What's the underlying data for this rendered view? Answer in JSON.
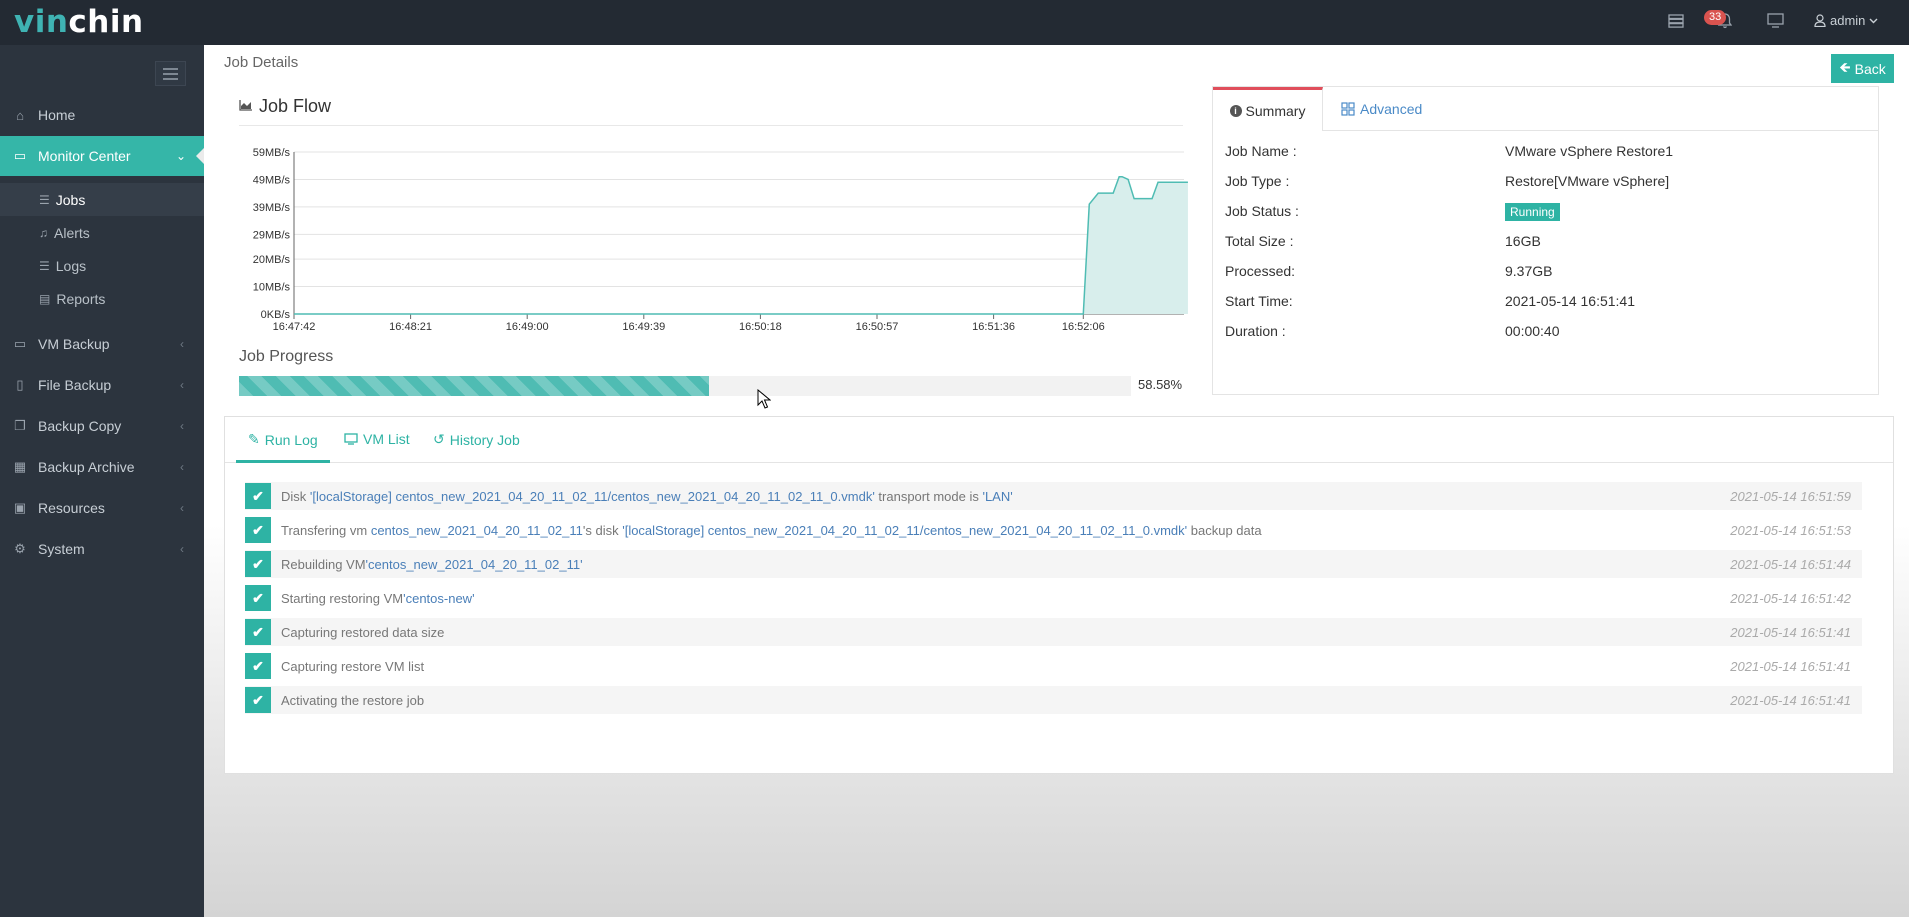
{
  "header": {
    "logo_part1": "vin",
    "logo_part2": "chin",
    "notification_count": "33",
    "user": "admin"
  },
  "sidebar": {
    "items": [
      {
        "label": "Home",
        "icon": "home-icon"
      },
      {
        "label": "Monitor Center",
        "icon": "monitor-icon"
      },
      {
        "label": "VM Backup",
        "icon": "vm-icon"
      },
      {
        "label": "File Backup",
        "icon": "file-icon"
      },
      {
        "label": "Backup Copy",
        "icon": "copy-icon"
      },
      {
        "label": "Backup Archive",
        "icon": "archive-icon"
      },
      {
        "label": "Resources",
        "icon": "resources-icon"
      },
      {
        "label": "System",
        "icon": "gear-icon"
      }
    ],
    "sub_items": [
      {
        "label": "Jobs",
        "icon": "list-icon"
      },
      {
        "label": "Alerts",
        "icon": "bell-icon"
      },
      {
        "label": "Logs",
        "icon": "list-icon"
      },
      {
        "label": "Reports",
        "icon": "report-icon"
      }
    ]
  },
  "page": {
    "title": "Job Details",
    "back_label": "Back"
  },
  "jobflow": {
    "title": "Job Flow"
  },
  "chart_data": {
    "type": "area",
    "title": "Job Flow",
    "y_ticks": [
      "0KB/s",
      "10MB/s",
      "20MB/s",
      "29MB/s",
      "39MB/s",
      "49MB/s",
      "59MB/s"
    ],
    "x_ticks": [
      "16:47:42",
      "16:48:21",
      "16:49:00",
      "16:49:39",
      "16:50:18",
      "16:50:57",
      "16:51:36",
      "16:52:06"
    ],
    "ylim": [
      0,
      59
    ],
    "unit": "MB/s",
    "x": [
      "16:52:06",
      "16:52:08",
      "16:52:11",
      "16:52:13",
      "16:52:16",
      "16:52:18",
      "16:52:19",
      "16:52:21",
      "16:52:23",
      "16:52:26",
      "16:52:29",
      "16:52:31",
      "16:52:33",
      "16:52:36",
      "16:52:38",
      "16:52:41"
    ],
    "values": [
      0,
      40,
      44,
      44,
      44,
      50,
      50,
      49,
      42,
      42,
      42,
      48,
      48,
      48,
      48,
      48
    ],
    "grid": true,
    "color": "#4fbcb3"
  },
  "progress": {
    "title": "Job Progress",
    "value": 58.58,
    "label": "58.58%"
  },
  "summary": {
    "tab_summary": "Summary",
    "tab_advanced": "Advanced",
    "rows": [
      {
        "key": "Job Name :",
        "value": "VMware vSphere Restore1"
      },
      {
        "key": "Job Type :",
        "value": "Restore[VMware vSphere]"
      },
      {
        "key": "Job Status :",
        "value": "Running"
      },
      {
        "key": "Total Size :",
        "value": "16GB"
      },
      {
        "key": "Processed:",
        "value": "9.37GB"
      },
      {
        "key": "Start Time:",
        "value": "2021-05-14 16:51:41"
      },
      {
        "key": "Duration :",
        "value": "00:00:40"
      }
    ]
  },
  "log": {
    "tabs": [
      "Run Log",
      "VM List",
      "History Job"
    ],
    "rows": [
      {
        "p1": "Disk ",
        "h1": "'[localStorage] centos_new_2021_04_20_11_02_11/centos_new_2021_04_20_11_02_11_0.vmdk'",
        "p2": " transport mode is ",
        "h2": "'LAN'",
        "p3": "",
        "h3": "",
        "p4": "",
        "time": "2021-05-14 16:51:59"
      },
      {
        "p1": "Transfering vm ",
        "h1": "centos_new_2021_04_20_11_02_11",
        "p2": "'s disk ",
        "h2": "'[localStorage] centos_new_2021_04_20_11_02_11/centos_new_2021_04_20_11_02_11_0.vmdk'",
        "p3": " backup data",
        "h3": "",
        "p4": "",
        "time": "2021-05-14 16:51:53"
      },
      {
        "p1": "Rebuilding VM",
        "h1": "'centos_new_2021_04_20_11_02_11'",
        "p2": "",
        "h2": "",
        "p3": "",
        "h3": "",
        "p4": "",
        "time": "2021-05-14 16:51:44"
      },
      {
        "p1": "Starting restoring VM",
        "h1": "'centos-new'",
        "p2": "",
        "h2": "",
        "p3": "",
        "h3": "",
        "p4": "",
        "time": "2021-05-14 16:51:42"
      },
      {
        "p1": "Capturing restored data size",
        "h1": "",
        "p2": "",
        "h2": "",
        "p3": "",
        "h3": "",
        "p4": "",
        "time": "2021-05-14 16:51:41"
      },
      {
        "p1": "Capturing restore VM list",
        "h1": "",
        "p2": "",
        "h2": "",
        "p3": "",
        "h3": "",
        "p4": "",
        "time": "2021-05-14 16:51:41"
      },
      {
        "p1": "Activating the restore job",
        "h1": "",
        "p2": "",
        "h2": "",
        "p3": "",
        "h3": "",
        "p4": "",
        "time": "2021-05-14 16:51:41"
      }
    ]
  }
}
